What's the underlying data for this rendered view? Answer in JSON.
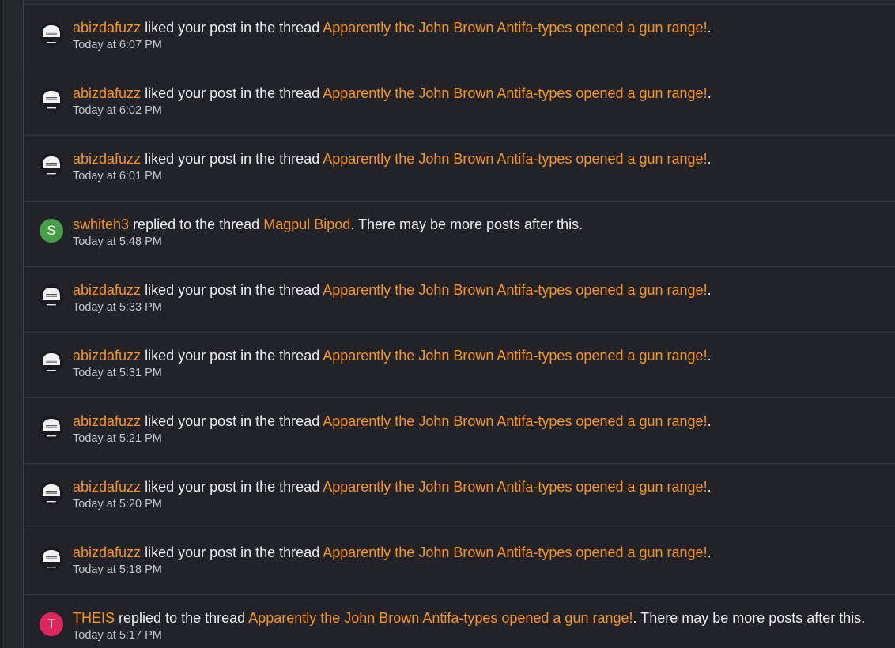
{
  "alerts": [
    {
      "user": "abizdafuzz",
      "action": "liked your post in the thread",
      "thread": "Apparently the John Brown Antifa-types opened a gun range!",
      "suffix": ".",
      "time": "Today at 6:07 PM",
      "avatar": "image"
    },
    {
      "user": "abizdafuzz",
      "action": "liked your post in the thread",
      "thread": "Apparently the John Brown Antifa-types opened a gun range!",
      "suffix": ".",
      "time": "Today at 6:02 PM",
      "avatar": "image"
    },
    {
      "user": "abizdafuzz",
      "action": "liked your post in the thread",
      "thread": "Apparently the John Brown Antifa-types opened a gun range!",
      "suffix": ".",
      "time": "Today at 6:01 PM",
      "avatar": "image"
    },
    {
      "user": "swhiteh3",
      "action": "replied to the thread",
      "thread": "Magpul Bipod",
      "suffix": ". There may be more posts after this.",
      "time": "Today at 5:48 PM",
      "avatar": "letter",
      "letter": "S",
      "avatar_color": "#43a047"
    },
    {
      "user": "abizdafuzz",
      "action": "liked your post in the thread",
      "thread": "Apparently the John Brown Antifa-types opened a gun range!",
      "suffix": ".",
      "time": "Today at 5:33 PM",
      "avatar": "image"
    },
    {
      "user": "abizdafuzz",
      "action": "liked your post in the thread",
      "thread": "Apparently the John Brown Antifa-types opened a gun range!",
      "suffix": ".",
      "time": "Today at 5:31 PM",
      "avatar": "image"
    },
    {
      "user": "abizdafuzz",
      "action": "liked your post in the thread",
      "thread": "Apparently the John Brown Antifa-types opened a gun range!",
      "suffix": ".",
      "time": "Today at 5:21 PM",
      "avatar": "image"
    },
    {
      "user": "abizdafuzz",
      "action": "liked your post in the thread",
      "thread": "Apparently the John Brown Antifa-types opened a gun range!",
      "suffix": ".",
      "time": "Today at 5:20 PM",
      "avatar": "image"
    },
    {
      "user": "abizdafuzz",
      "action": "liked your post in the thread",
      "thread": "Apparently the John Brown Antifa-types opened a gun range!",
      "suffix": ".",
      "time": "Today at 5:18 PM",
      "avatar": "image"
    },
    {
      "user": "THEIS",
      "action": "replied to the thread",
      "thread": "Apparently the John Brown Antifa-types opened a gun range!",
      "suffix": ". There may be more posts after this.",
      "time": "Today at 5:17 PM",
      "avatar": "letter",
      "letter": "T",
      "avatar_color": "#e0245e"
    }
  ],
  "colors": {
    "link": "#f7941d",
    "text": "#ececec",
    "time": "#c4c6cc",
    "background": "#222328"
  }
}
